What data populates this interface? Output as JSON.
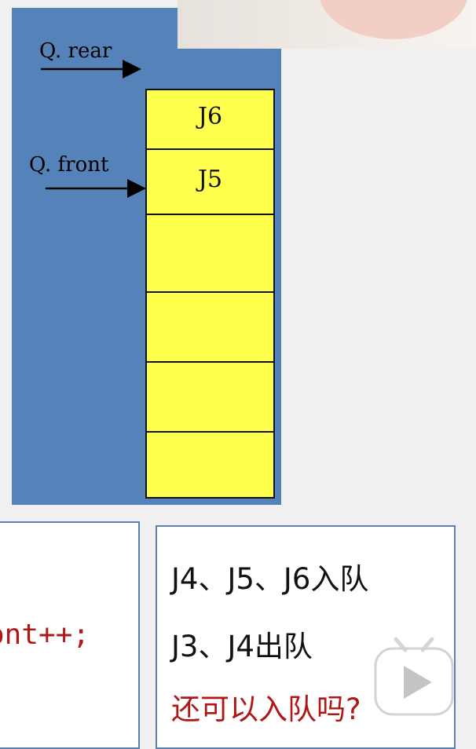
{
  "diagram": {
    "pointers": {
      "rear": "Q. rear",
      "front": "Q. front"
    },
    "cells": [
      "J6",
      "J5",
      "",
      "",
      "",
      ""
    ]
  },
  "code_box": {
    "text": "ont++;"
  },
  "note_box": {
    "line1": "J4、J5、J6入队",
    "line2": "J3、J4出队",
    "line3": "还可以入队吗?"
  },
  "colors": {
    "panel": "#5582b8",
    "queue_fill": "#ffff4d",
    "red_text": "#b01818"
  },
  "icons": {
    "play": "play-icon"
  }
}
